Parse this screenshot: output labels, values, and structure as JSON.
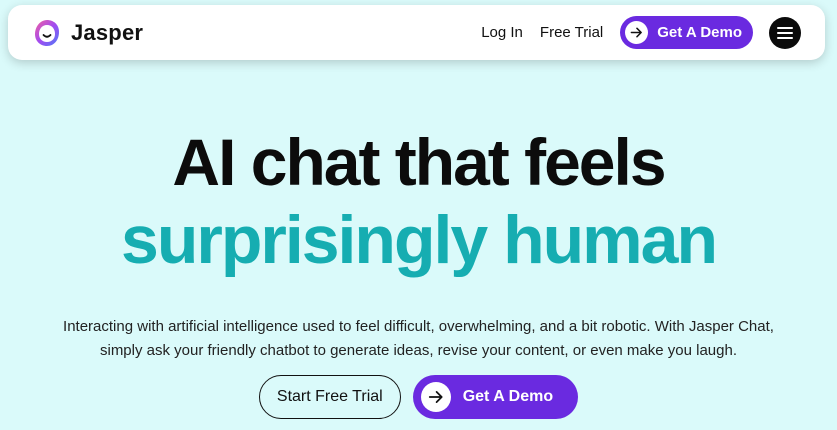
{
  "header": {
    "brand": "Jasper",
    "login_label": "Log In",
    "free_trial_label": "Free Trial",
    "demo_label": "Get A Demo",
    "menu_icon": "hamburger-menu-icon"
  },
  "hero": {
    "headline_line1": "AI chat that feels",
    "headline_line2": "surprisingly human",
    "description": "Interacting with artificial intelligence used to feel difficult, overwhelming, and a bit robotic. With Jasper Chat, simply ask your friendly chatbot to generate ideas, revise your content, or even make you laugh.",
    "primary_cta_label": "Start Free Trial",
    "secondary_cta_label": "Get A Demo"
  },
  "colors": {
    "background": "#dafafa",
    "accent_purple": "#6a2ae0",
    "accent_teal": "#16adb1"
  }
}
